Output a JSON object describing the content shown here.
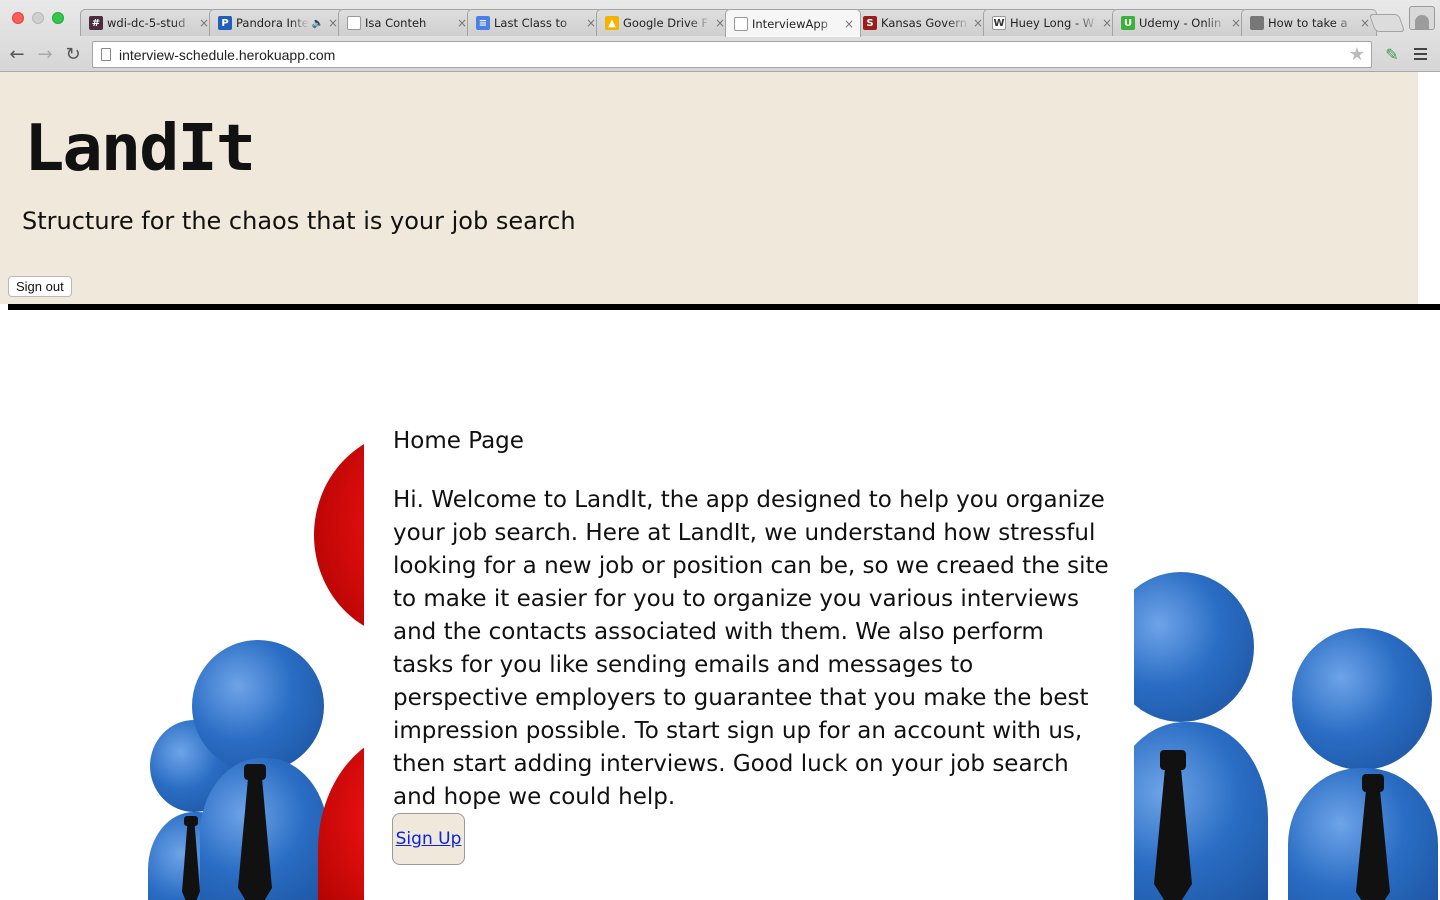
{
  "browser": {
    "tabs": [
      {
        "title": "wdi-dc-5-stud",
        "favicon": "hash-icon",
        "fav_text": "#",
        "fav_color": "#4a2c3f"
      },
      {
        "title": "Pandora Inte",
        "favicon": "pandora-icon",
        "fav_text": "P",
        "fav_color": "#2060b8",
        "audio": "🔈"
      },
      {
        "title": "Isa Conteh",
        "favicon": "page-icon",
        "fav_text": "",
        "fav_color": "#ffffff"
      },
      {
        "title": "Last Class to",
        "favicon": "docs-icon",
        "fav_text": "≡",
        "fav_color": "#4a7fe6"
      },
      {
        "title": "Google Drive F",
        "favicon": "drive-icon",
        "fav_text": "▲",
        "fav_color": "#f2b400"
      },
      {
        "title": "InterviewApp",
        "favicon": "page-icon",
        "fav_text": "",
        "fav_color": "#ffffff",
        "active": true
      },
      {
        "title": "Kansas Govern",
        "favicon": "s-icon",
        "fav_text": "S",
        "fav_color": "#9b1c1c"
      },
      {
        "title": "Huey Long - W",
        "favicon": "wikipedia-icon",
        "fav_text": "W",
        "fav_color": "#ffffff"
      },
      {
        "title": "Udemy - Onlin",
        "favicon": "udemy-icon",
        "fav_text": "U",
        "fav_color": "#3bb03b"
      },
      {
        "title": "How to take a",
        "favicon": "apple-icon",
        "fav_text": "",
        "fav_color": "#777777"
      }
    ],
    "tab_close": "×",
    "url": "interview-schedule.herokuapp.com",
    "back_glyph": "←",
    "forward_glyph": "→",
    "reload_glyph": "↻",
    "star_glyph": "★",
    "ext_glyph": "✎"
  },
  "header": {
    "logo": "LandIt",
    "tagline": "Structure for the chaos that is your job search",
    "sign_out_label": "Sign out",
    "background": "#f0e8da"
  },
  "main": {
    "title": "Home Page",
    "body": "Hi. Welcome to LandIt, the app designed to help you organize your job search. Here at LandIt, we understand how stressful looking for a new job or position can be, so we creaed the site to make it easier for you to organize you various interviews and the contacts associated with them. We also perform tasks for you like sending emails and messages to perspective employers to guarantee that you make the best impression possible. To start sign up for an account with us, then start adding interviews. Good luck on your job search and hope we could help.",
    "sign_up_label": "Sign Up",
    "link_color": "#0b24d8"
  }
}
